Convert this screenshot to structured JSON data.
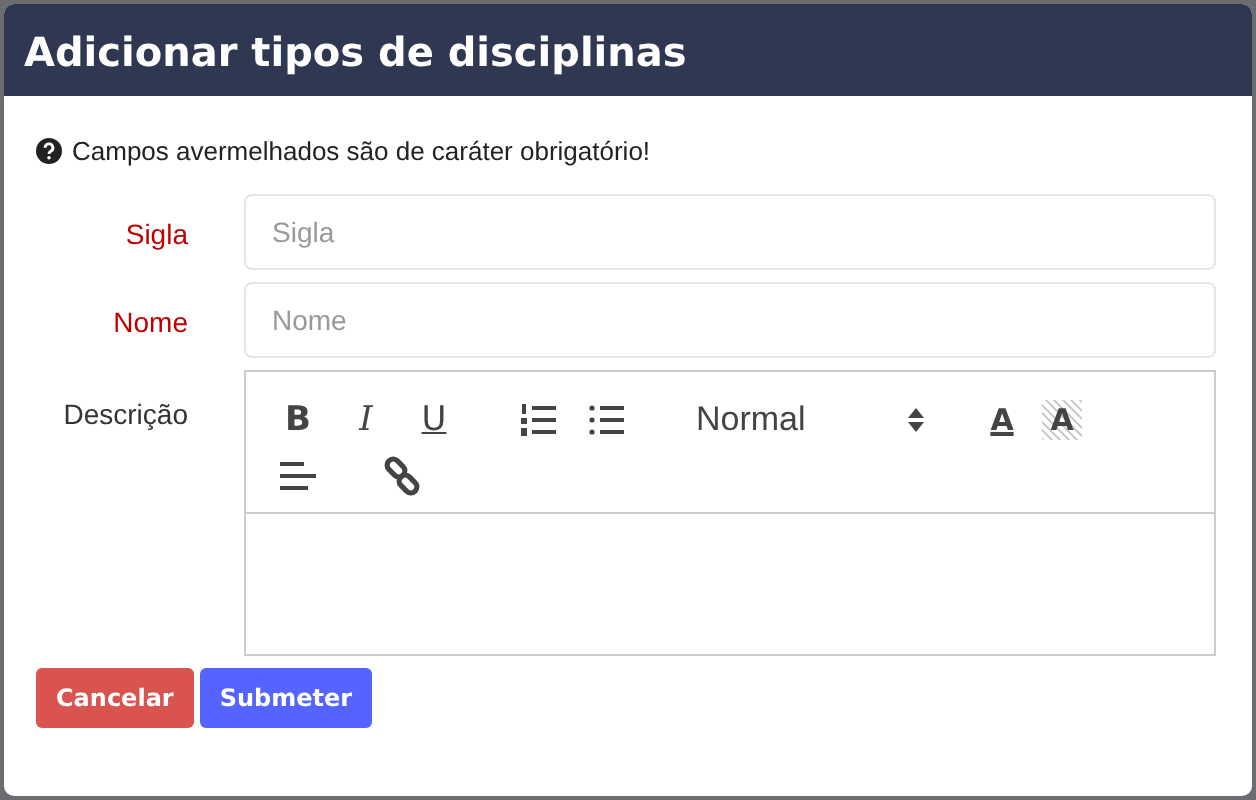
{
  "dialog": {
    "title": "Adicionar tipos de disciplinas"
  },
  "notice": "Campos avermelhados são de caráter obrigatório!",
  "fields": [
    {
      "kind": "input",
      "label": "Sigla",
      "required": true,
      "placeholder": "Sigla"
    },
    {
      "kind": "input",
      "label": "Nome",
      "required": true,
      "placeholder": "Nome"
    },
    {
      "kind": "editor",
      "label": "Descrição",
      "required": false
    }
  ],
  "toolbar": [
    {
      "kind": "bold",
      "label": "B"
    },
    {
      "kind": "italic",
      "label": "I"
    },
    {
      "kind": "underline",
      "label": "U"
    },
    {
      "kind": "ordered-list"
    },
    {
      "kind": "bullet-list"
    },
    {
      "kind": "select",
      "label": "Normal"
    },
    {
      "kind": "color",
      "label": "A"
    },
    {
      "kind": "background",
      "label": "A"
    },
    {
      "kind": "align"
    },
    {
      "kind": "link"
    }
  ],
  "buttons": [
    {
      "kind": "danger",
      "label": "Cancelar"
    },
    {
      "kind": "primary",
      "label": "Submeter"
    }
  ]
}
